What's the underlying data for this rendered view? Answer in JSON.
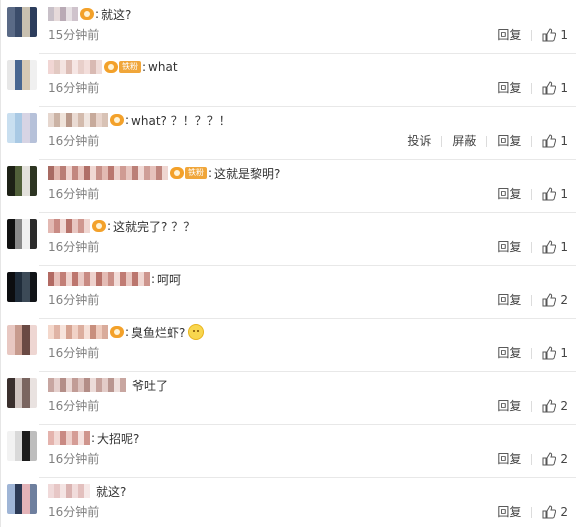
{
  "actions": {
    "report": "投诉",
    "block": "屏蔽",
    "reply": "回复"
  },
  "comments": [
    {
      "time": "15分钟前",
      "text": "就这?",
      "likes": "1"
    },
    {
      "time": "16分钟前",
      "text": "what",
      "likes": "1",
      "badge": "铁粉"
    },
    {
      "time": "16分钟前",
      "text": "what? ？！？？！",
      "likes": "1"
    },
    {
      "time": "16分钟前",
      "text": "这就是黎明?",
      "likes": "1",
      "badge": "铁粉"
    },
    {
      "time": "16分钟前",
      "text": "这就完了? ？？",
      "likes": "1"
    },
    {
      "time": "16分钟前",
      "text": "呵呵",
      "likes": "2"
    },
    {
      "time": "16分钟前",
      "text": "臭鱼烂虾?",
      "likes": "1"
    },
    {
      "time": "16分钟前",
      "text": "爷吐了",
      "likes": "2"
    },
    {
      "time": "16分钟前",
      "text": "大招呢?",
      "likes": "2"
    },
    {
      "time": "16分钟前",
      "text": "就这?",
      "likes": "2"
    }
  ]
}
